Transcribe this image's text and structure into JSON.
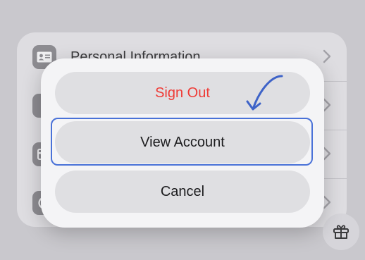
{
  "background": {
    "rows": [
      {
        "label": "Personal Information",
        "icon": "id-card-icon"
      },
      {
        "label": "",
        "icon": "lock-icon"
      },
      {
        "label": "",
        "icon": "creditcard-icon"
      },
      {
        "label": "",
        "icon": "subscriptions-icon"
      }
    ],
    "corner_icon": "gift-icon"
  },
  "sheet": {
    "sign_out_label": "Sign Out",
    "view_account_label": "View Account",
    "cancel_label": "Cancel"
  },
  "colors": {
    "destructive": "#ef3b36",
    "highlight": "#4a72d8",
    "arrow": "#3e63c8"
  }
}
